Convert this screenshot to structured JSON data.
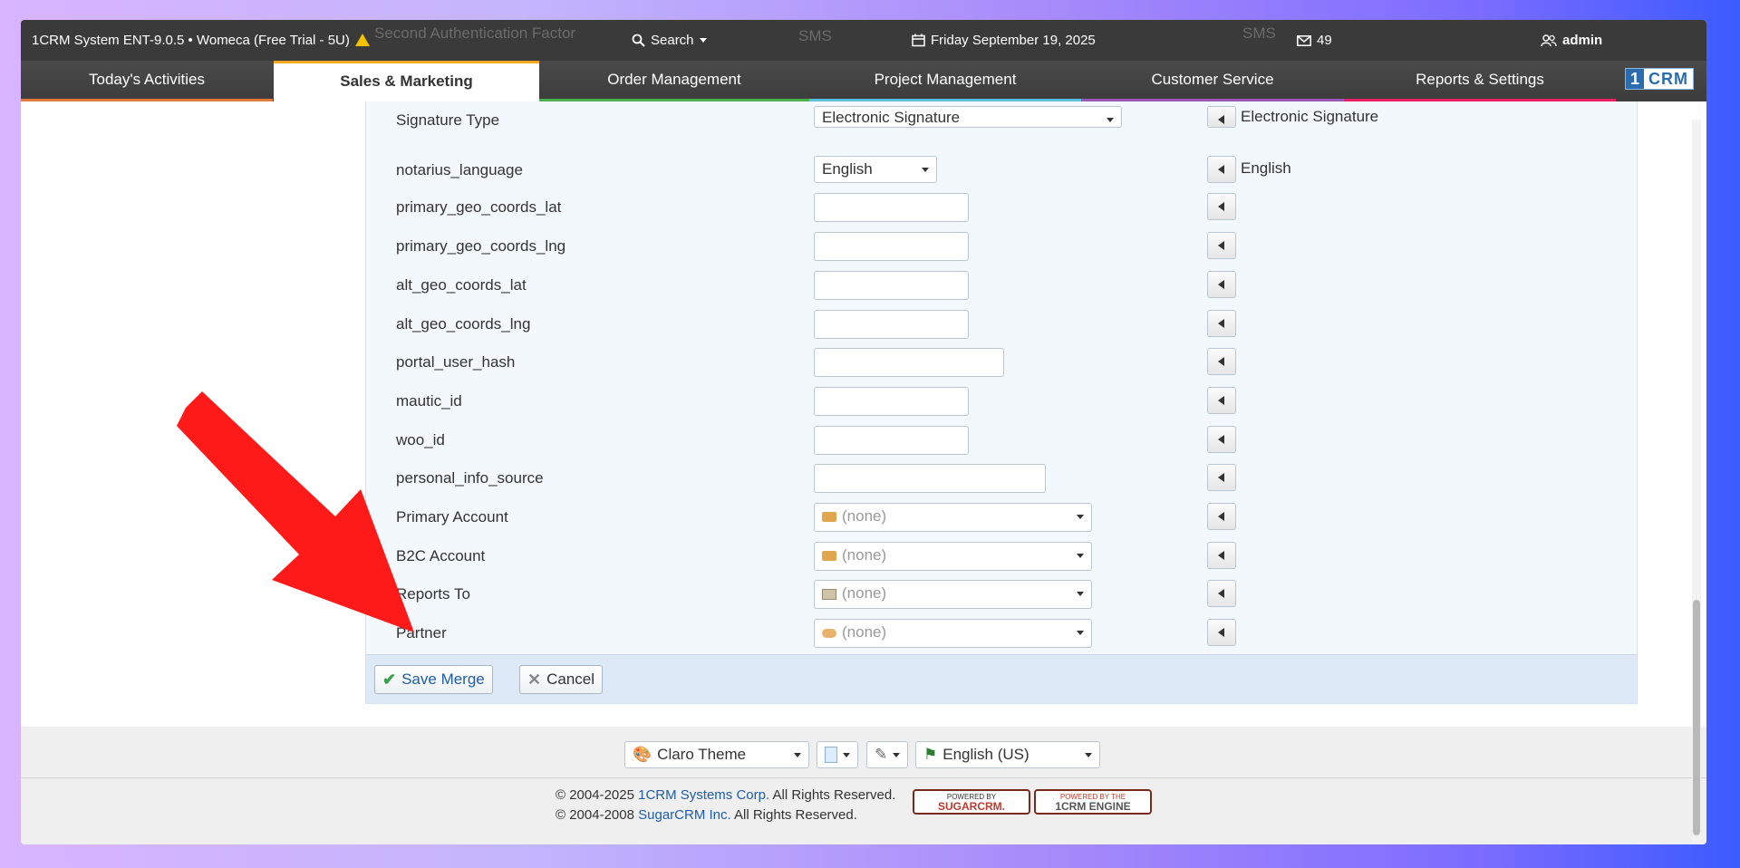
{
  "topbar": {
    "app_title": "1CRM System ENT-9.0.5 • Womeca (Free Trial - 5U)",
    "search_label": "Search",
    "date": "Friday September 19, 2025",
    "mail_count": "49",
    "user": "admin",
    "ghost_left": "Second Authentication Factor",
    "ghost_mid": "SMS",
    "ghost_right": "SMS"
  },
  "nav": {
    "tabs": [
      {
        "label": "Today's Activities",
        "underline": "#e07b39"
      },
      {
        "label": "Sales & Marketing",
        "underline": "#f5a623"
      },
      {
        "label": "Order Management",
        "underline": "#4caf50"
      },
      {
        "label": "Project Management",
        "underline": "#5bc0de"
      },
      {
        "label": "Customer Service",
        "underline": "#9b59b6"
      },
      {
        "label": "Reports & Settings",
        "underline": "#e91e63"
      }
    ],
    "logo_one": "1",
    "logo_crm": "CRM"
  },
  "form": {
    "rows": [
      {
        "label": "Signature Type",
        "value": "Electronic Signature",
        "right_value": "Electronic Signature"
      },
      {
        "label": "notarius_language",
        "value": "English",
        "right_value": "English"
      },
      {
        "label": "primary_geo_coords_lat",
        "value": "",
        "right_value": ""
      },
      {
        "label": "primary_geo_coords_lng",
        "value": "",
        "right_value": ""
      },
      {
        "label": "alt_geo_coords_lat",
        "value": "",
        "right_value": ""
      },
      {
        "label": "alt_geo_coords_lng",
        "value": "",
        "right_value": ""
      },
      {
        "label": "portal_user_hash",
        "value": "",
        "right_value": ""
      },
      {
        "label": "mautic_id",
        "value": "",
        "right_value": ""
      },
      {
        "label": "woo_id",
        "value": "",
        "right_value": ""
      },
      {
        "label": "personal_info_source",
        "value": "",
        "right_value": ""
      },
      {
        "label": "Primary Account",
        "value": "(none)",
        "icon": "folder-icon"
      },
      {
        "label": "B2C Account",
        "value": "(none)",
        "icon": "folder-icon"
      },
      {
        "label": "Reports To",
        "value": "(none)",
        "icon": "contact-card-icon"
      },
      {
        "label": "Partner",
        "value": "(none)",
        "icon": "handshake-icon"
      }
    ],
    "save_label": "Save Merge",
    "cancel_label": "Cancel"
  },
  "footer": {
    "theme": "Claro Theme",
    "language": "English (US)",
    "copyright_1_pre": "© 2004-2025",
    "copyright_1_link": "1CRM Systems Corp.",
    "copyright_1_post": "All Rights Reserved.",
    "copyright_2_pre": "© 2004-2008",
    "copyright_2_link": "SugarCRM Inc.",
    "copyright_2_post": "All Rights Reserved.",
    "badge1_top": "POWERED BY",
    "badge1_main": "SUGARCRM.",
    "badge2_top": "POWERED BY THE",
    "badge2_main": "1CRM ENGINE"
  },
  "colors": {
    "accent": "#f5a623",
    "annotation": "#ff1a1a",
    "link": "#1f5da8"
  }
}
